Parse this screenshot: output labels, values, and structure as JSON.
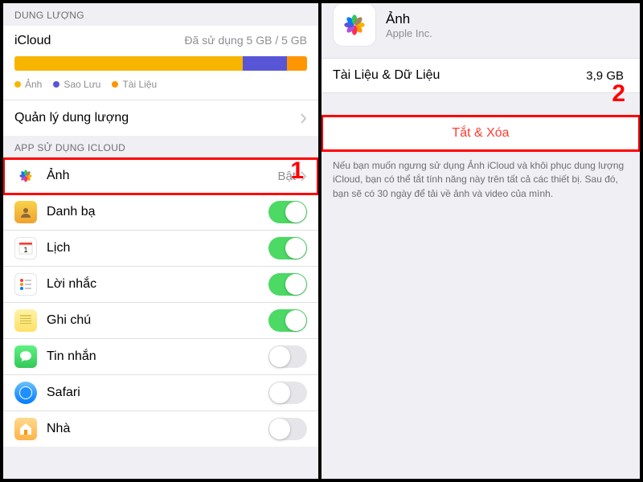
{
  "left": {
    "storage_header": "DUNG LƯỢNG",
    "storage_title": "iCloud",
    "storage_used": "Đã sử dụng 5 GB / 5 GB",
    "legend": {
      "photos": "Ảnh",
      "backup": "Sao Lưu",
      "docs": "Tài Liệu"
    },
    "manage": "Quản lý dung lượng",
    "apps_header": "APP SỬ DỤNG ICLOUD",
    "photos_label": "Ảnh",
    "photos_value": "Bật",
    "items": {
      "contacts": "Danh bạ",
      "calendar": "Lịch",
      "reminders": "Lời nhắc",
      "notes": "Ghi chú",
      "messages": "Tin nhắn",
      "safari": "Safari",
      "home": "Nhà"
    },
    "annotation": "1"
  },
  "right": {
    "app_name": "Ảnh",
    "vendor": "Apple Inc.",
    "docs_label": "Tài Liệu & Dữ Liệu",
    "docs_value": "3,9 GB",
    "action": "Tắt & Xóa",
    "footer": "Nếu bạn muốn ngưng sử dụng Ảnh iCloud và khôi phục dung lượng iCloud, bạn có thể tắt tính năng này trên tất cả các thiết bị. Sau đó, bạn sẽ có 30 ngày để tải về ảnh và video của mình.",
    "annotation": "2"
  }
}
